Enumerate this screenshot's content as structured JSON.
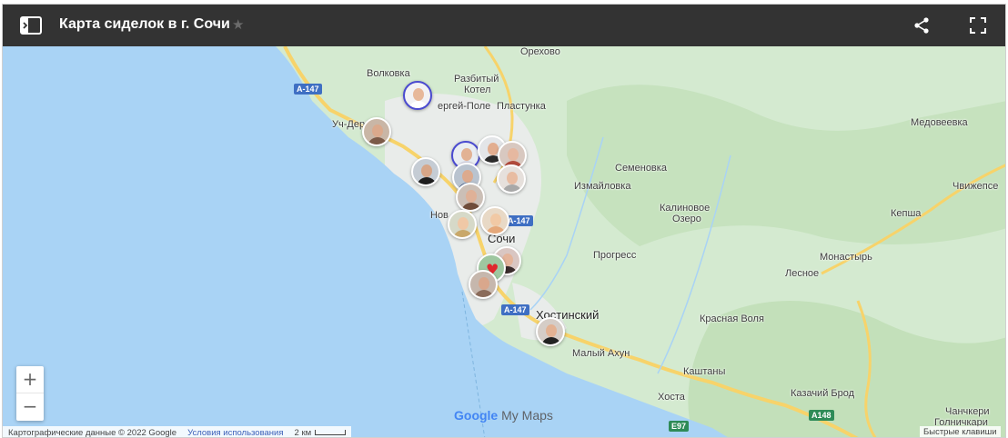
{
  "header": {
    "title": "Карта сиделок в г. Сочи",
    "star_icon": "star-icon",
    "share_icon": "share-icon",
    "fullscreen_icon": "fullscreen-icon",
    "sidebar_icon": "sidebar-toggle-icon"
  },
  "map": {
    "places": [
      {
        "id": "orekhovo",
        "label": "Орехово"
      },
      {
        "id": "volkovka",
        "label": "Волковка"
      },
      {
        "id": "razbityi",
        "label": "Разбитый"
      },
      {
        "id": "kotel",
        "label": "Котел"
      },
      {
        "id": "sergei",
        "label": "ергей-Поле"
      },
      {
        "id": "plastunka",
        "label": "Пластунка"
      },
      {
        "id": "uchder",
        "label": "Уч-Дер"
      },
      {
        "id": "medoveevka",
        "label": "Медовеевка"
      },
      {
        "id": "semenovka",
        "label": "Семеновка"
      },
      {
        "id": "izmailovka",
        "label": "Измайловка"
      },
      {
        "id": "chvizhepse",
        "label": "Чвижепсе"
      },
      {
        "id": "kalinovoe",
        "label": "Калиновое"
      },
      {
        "id": "ozero",
        "label": "Озеро"
      },
      {
        "id": "kepsha",
        "label": "Кепша"
      },
      {
        "id": "nov",
        "label": "Нов"
      },
      {
        "id": "sochi",
        "label": "Сочи"
      },
      {
        "id": "progress",
        "label": "Прогресс"
      },
      {
        "id": "monastyr",
        "label": "Монастырь"
      },
      {
        "id": "lesnoe",
        "label": "Лесное"
      },
      {
        "id": "khostinsky",
        "label": "Хостинский"
      },
      {
        "id": "krasnaya",
        "label": "Красная Воля"
      },
      {
        "id": "malyi",
        "label": "Малый Ахун"
      },
      {
        "id": "kashtany",
        "label": "Каштаны"
      },
      {
        "id": "khosta",
        "label": "Хоста"
      },
      {
        "id": "kazachiy",
        "label": "Казачий Брод"
      },
      {
        "id": "chanchkeri",
        "label": "Чанчкери"
      },
      {
        "id": "golnichkari",
        "label": "Голничкари"
      }
    ],
    "roads": [
      {
        "id": "a147-1",
        "label": "A-147"
      },
      {
        "id": "a147-2",
        "label": "A-147"
      },
      {
        "id": "a147-3",
        "label": "A-147"
      },
      {
        "id": "e97",
        "label": "E97"
      },
      {
        "id": "a148",
        "label": "A148"
      }
    ],
    "markers_count_note": "caregiver photo markers",
    "colors": {
      "water": "#a9d3f5",
      "land": "#d4ead0",
      "land_dark": "#bfdfb6",
      "urban": "#ececec",
      "highway": "#f7d36a",
      "topbar": "#333333",
      "heart": "#e0282e"
    }
  },
  "controls": {
    "zoom_in": "+",
    "zoom_out": "−"
  },
  "footer": {
    "logo_google": "Google",
    "logo_mymaps": "My Maps",
    "map_data": "Картографические данные © 2022 Google",
    "terms": "Условия использования",
    "scale": "2 км",
    "shortcuts": "Быстрые клавиши"
  }
}
